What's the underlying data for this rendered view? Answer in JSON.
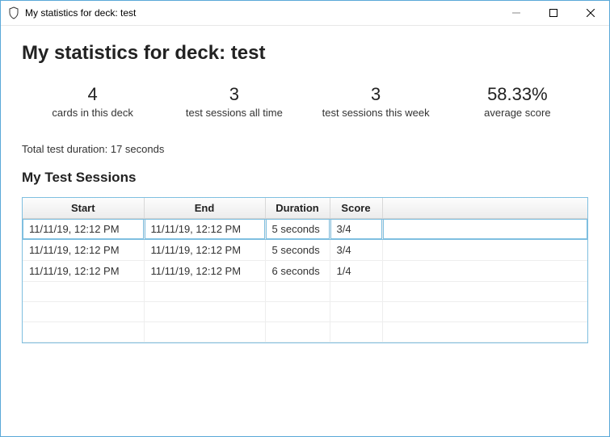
{
  "window": {
    "title": "My statistics for deck: test"
  },
  "header": {
    "title": "My statistics for deck: test"
  },
  "stats": [
    {
      "value": "4",
      "label": "cards in this deck"
    },
    {
      "value": "3",
      "label": "test sessions all time"
    },
    {
      "value": "3",
      "label": "test sessions this week"
    },
    {
      "value": "58.33%",
      "label": "average score"
    }
  ],
  "total_duration": "Total test duration: 17 seconds",
  "sessions": {
    "title": "My Test Sessions",
    "columns": [
      "Start",
      "End",
      "Duration",
      "Score",
      ""
    ],
    "rows": [
      {
        "start": "11/11/19, 12:12 PM",
        "end": "11/11/19, 12:12 PM",
        "duration": "5 seconds",
        "score": "3/4",
        "selected": true
      },
      {
        "start": "11/11/19, 12:12 PM",
        "end": "11/11/19, 12:12 PM",
        "duration": "5 seconds",
        "score": "3/4",
        "selected": false
      },
      {
        "start": "11/11/19, 12:12 PM",
        "end": "11/11/19, 12:12 PM",
        "duration": "6 seconds",
        "score": "1/4",
        "selected": false
      }
    ],
    "empty_rows": 3
  }
}
